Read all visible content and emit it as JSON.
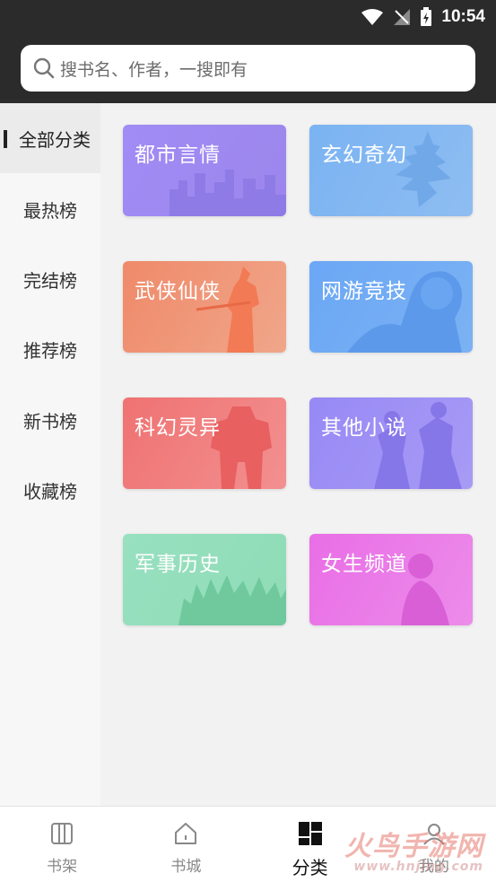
{
  "status_bar": {
    "time": "10:54"
  },
  "search": {
    "placeholder": "搜书名、作者，一搜即有"
  },
  "left_nav": {
    "items": [
      {
        "label": "全部分类",
        "active": true
      },
      {
        "label": "最热榜",
        "active": false
      },
      {
        "label": "完结榜",
        "active": false
      },
      {
        "label": "推荐榜",
        "active": false
      },
      {
        "label": "新书榜",
        "active": false
      },
      {
        "label": "收藏榜",
        "active": false
      }
    ]
  },
  "categories": [
    {
      "label": "都市言情",
      "color": "#a38df2",
      "decor": "city-skyline"
    },
    {
      "label": "玄幻奇幻",
      "color": "#77b1f0",
      "decor": "floating-temple"
    },
    {
      "label": "武侠仙侠",
      "color": "#ef8f6e",
      "decor": "swordsman"
    },
    {
      "label": "网游竞技",
      "color": "#6aa7f4",
      "decor": "game-character"
    },
    {
      "label": "科幻灵异",
      "color": "#f27b7b",
      "decor": "robot"
    },
    {
      "label": "其他小说",
      "color": "#9a8cf6",
      "decor": "warriors"
    },
    {
      "label": "军事历史",
      "color": "#8fdfb8",
      "decor": "army"
    },
    {
      "label": "女生频道",
      "color": "#e673e6",
      "decor": "girl"
    }
  ],
  "bottom_nav": {
    "tabs": [
      {
        "label": "书架",
        "icon": "bookshelf-icon",
        "active": false
      },
      {
        "label": "书城",
        "icon": "home-icon",
        "active": false
      },
      {
        "label": "分类",
        "icon": "category-icon",
        "active": true
      },
      {
        "label": "我的",
        "icon": "profile-icon",
        "active": false
      }
    ]
  },
  "watermark": {
    "text": "火鸟手游网",
    "sub": "www.hnjing.com"
  }
}
